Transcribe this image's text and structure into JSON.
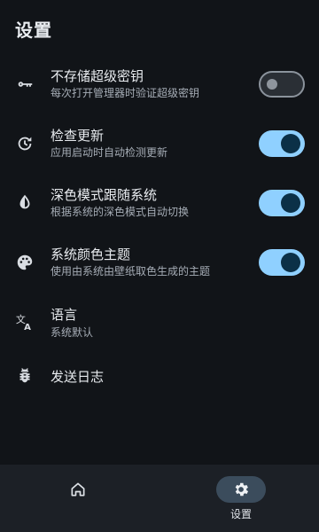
{
  "header": {
    "title": "设置"
  },
  "settings": [
    {
      "icon": "key-icon",
      "title": "不存储超级密钥",
      "subtitle": "每次打开管理器时验证超级密钥",
      "toggle": "off"
    },
    {
      "icon": "update-check-icon",
      "title": "检查更新",
      "subtitle": "应用启动时自动检测更新",
      "toggle": "on"
    },
    {
      "icon": "contrast-icon",
      "title": "深色模式跟随系统",
      "subtitle": "根据系统的深色模式自动切换",
      "toggle": "on"
    },
    {
      "icon": "palette-icon",
      "title": "系统颜色主题",
      "subtitle": "使用由系统由壁纸取色生成的主题",
      "toggle": "on"
    },
    {
      "icon": "translate-icon",
      "title": "语言",
      "subtitle": "系统默认"
    },
    {
      "icon": "bug-icon",
      "title": "发送日志"
    }
  ],
  "bottom_nav": {
    "home": {
      "icon": "home-icon",
      "label": ""
    },
    "settings": {
      "icon": "gear-icon",
      "label": "设置",
      "selected": true
    }
  },
  "colors": {
    "accent": "#8fd0ff",
    "background": "#111418",
    "nav_bg": "#1c2026"
  }
}
